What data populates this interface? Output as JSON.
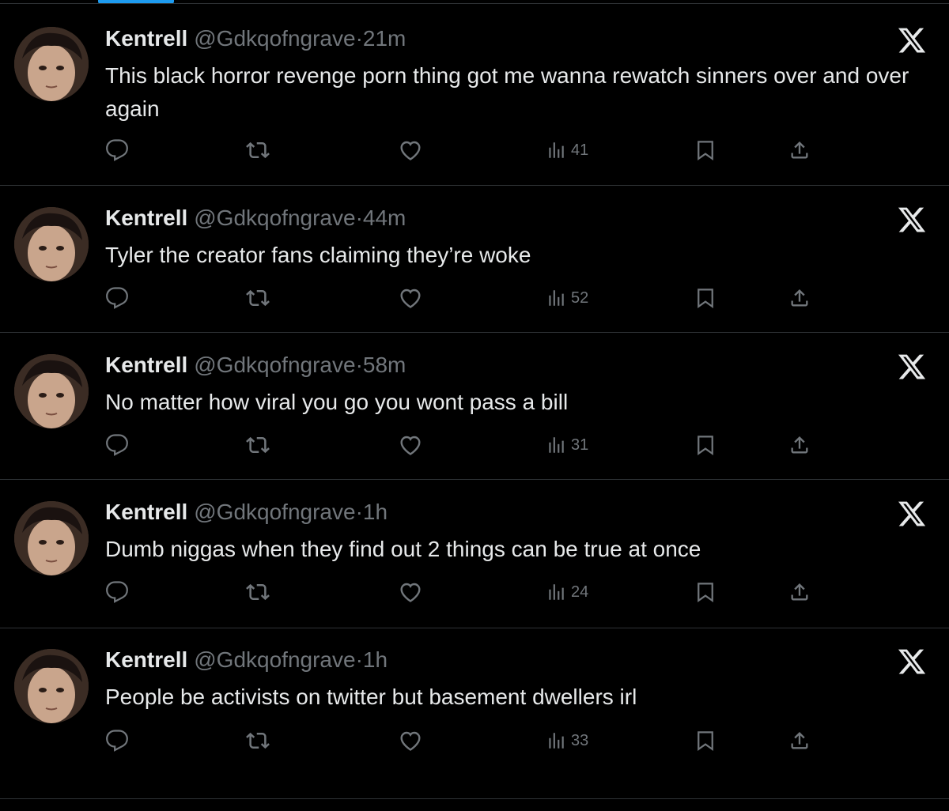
{
  "colors": {
    "background": "#000000",
    "primary_text": "#e7e9ea",
    "secondary_text": "#71767b",
    "divider": "#2f3336",
    "accent": "#1d9bf0"
  },
  "tweets": [
    {
      "name": "Kentrell",
      "handle": "@Gdkqofngrave",
      "dot": "·",
      "time": "21m",
      "text": "This black horror revenge porn thing got me wanna rewatch sinners over and over again",
      "views": "41"
    },
    {
      "name": "Kentrell",
      "handle": "@Gdkqofngrave",
      "dot": "·",
      "time": "44m",
      "text": "Tyler the creator fans claiming they’re woke",
      "views": "52"
    },
    {
      "name": "Kentrell",
      "handle": "@Gdkqofngrave",
      "dot": "·",
      "time": "58m",
      "text": "No matter how viral you go you wont pass a bill",
      "views": "31"
    },
    {
      "name": "Kentrell",
      "handle": "@Gdkqofngrave",
      "dot": "·",
      "time": "1h",
      "text": "Dumb niggas when they find out 2 things can be true at once",
      "views": "24"
    },
    {
      "name": "Kentrell",
      "handle": "@Gdkqofngrave",
      "dot": "·",
      "time": "1h",
      "text": "People be activists on twitter but basement dwellers irl",
      "views": "33"
    }
  ],
  "icons": {
    "platform": "x-logo-icon",
    "reply": "reply-icon",
    "retweet": "retweet-icon",
    "like": "heart-icon",
    "views": "views-icon",
    "bookmark": "bookmark-icon",
    "share": "share-icon"
  }
}
